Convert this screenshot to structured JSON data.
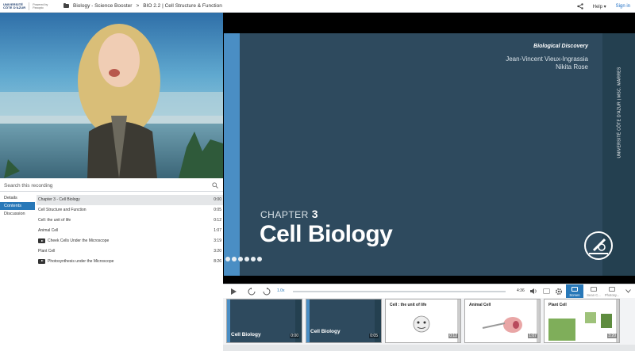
{
  "topbar": {
    "logo_top": "UNIVERSITÉ",
    "logo_bottom": "CÔTE D'AZUR",
    "powered_by": "Powered by",
    "powered_brand": "Panopto",
    "breadcrumb_folder": "Biology - Science Booster",
    "breadcrumb_sep": ">",
    "breadcrumb_session": "BIO 2.2 | Cell Structure & Function",
    "help_label": "Help",
    "help_caret": "▾",
    "signin_label": "Sign in"
  },
  "search": {
    "placeholder": "Search this recording"
  },
  "tabs": [
    "Details",
    "Contents",
    "Discussion"
  ],
  "contents": [
    {
      "title": "Chapter 3 - Cell Biology",
      "time": "0:00",
      "video": false
    },
    {
      "title": "Cell Structure and Function",
      "time": "0:05",
      "video": false
    },
    {
      "title": "Cell: the unit of life",
      "time": "0:12",
      "video": false
    },
    {
      "title": "Animal Cell",
      "time": "1:07",
      "video": false
    },
    {
      "title": "Cheek Cells Under the Microscope",
      "time": "3:19",
      "video": true
    },
    {
      "title": "Plant Cell",
      "time": "3:20",
      "video": false
    },
    {
      "title": "Photosynthesis under the Microscope",
      "time": "8:26",
      "video": true
    }
  ],
  "slide": {
    "series": "Biological Discovery",
    "author1": "Jean-Vincent Vieux-Ingrassia",
    "author2": "Nikita Rose",
    "chapter_word": "CHAPTER",
    "chapter_num": "3",
    "heading": "Cell Biology",
    "vertical": "UNIVERSITÉ CÔTE D'AZUR | MSC. MARRES"
  },
  "player": {
    "speed": "1.0x",
    "time": "4:36",
    "screen_label": "Screen",
    "cam_label": "Sean C...",
    "photo_label": "Photosy..."
  },
  "thumbnails": [
    {
      "title": "Cell Biology",
      "time": "0:00",
      "kind": "dark"
    },
    {
      "title": "Cell Biology",
      "time": "0:05",
      "kind": "dark"
    },
    {
      "title": "Cell : the unit of life",
      "time": "0:12",
      "kind": "light"
    },
    {
      "title": "Animal Cell",
      "time": "1:07",
      "kind": "light"
    },
    {
      "title": "Plant Cell",
      "time": "3:20",
      "kind": "light"
    }
  ],
  "colors": {
    "accent": "#2878b8",
    "slide_bg": "#2e4a5e",
    "slide_strip": "#4a8ec4"
  }
}
